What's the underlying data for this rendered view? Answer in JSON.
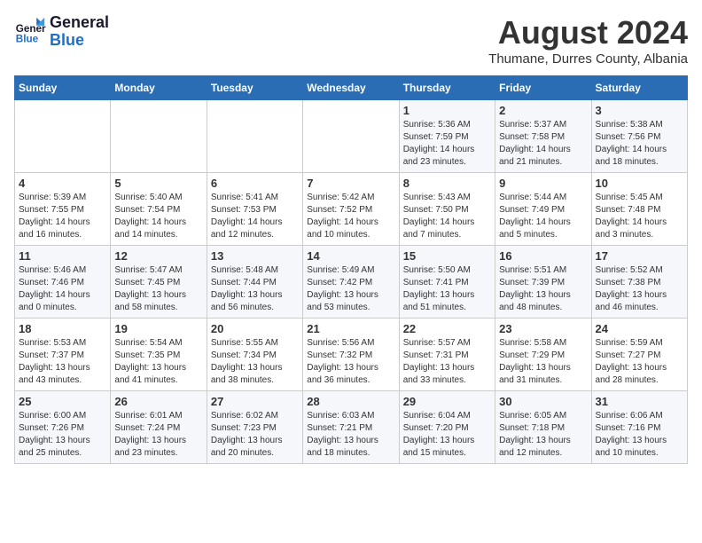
{
  "header": {
    "logo_line1": "General",
    "logo_line2": "Blue",
    "month_year": "August 2024",
    "location": "Thumane, Durres County, Albania"
  },
  "weekdays": [
    "Sunday",
    "Monday",
    "Tuesday",
    "Wednesday",
    "Thursday",
    "Friday",
    "Saturday"
  ],
  "weeks": [
    [
      {
        "day": "",
        "info": ""
      },
      {
        "day": "",
        "info": ""
      },
      {
        "day": "",
        "info": ""
      },
      {
        "day": "",
        "info": ""
      },
      {
        "day": "1",
        "info": "Sunrise: 5:36 AM\nSunset: 7:59 PM\nDaylight: 14 hours\nand 23 minutes."
      },
      {
        "day": "2",
        "info": "Sunrise: 5:37 AM\nSunset: 7:58 PM\nDaylight: 14 hours\nand 21 minutes."
      },
      {
        "day": "3",
        "info": "Sunrise: 5:38 AM\nSunset: 7:56 PM\nDaylight: 14 hours\nand 18 minutes."
      }
    ],
    [
      {
        "day": "4",
        "info": "Sunrise: 5:39 AM\nSunset: 7:55 PM\nDaylight: 14 hours\nand 16 minutes."
      },
      {
        "day": "5",
        "info": "Sunrise: 5:40 AM\nSunset: 7:54 PM\nDaylight: 14 hours\nand 14 minutes."
      },
      {
        "day": "6",
        "info": "Sunrise: 5:41 AM\nSunset: 7:53 PM\nDaylight: 14 hours\nand 12 minutes."
      },
      {
        "day": "7",
        "info": "Sunrise: 5:42 AM\nSunset: 7:52 PM\nDaylight: 14 hours\nand 10 minutes."
      },
      {
        "day": "8",
        "info": "Sunrise: 5:43 AM\nSunset: 7:50 PM\nDaylight: 14 hours\nand 7 minutes."
      },
      {
        "day": "9",
        "info": "Sunrise: 5:44 AM\nSunset: 7:49 PM\nDaylight: 14 hours\nand 5 minutes."
      },
      {
        "day": "10",
        "info": "Sunrise: 5:45 AM\nSunset: 7:48 PM\nDaylight: 14 hours\nand 3 minutes."
      }
    ],
    [
      {
        "day": "11",
        "info": "Sunrise: 5:46 AM\nSunset: 7:46 PM\nDaylight: 14 hours\nand 0 minutes."
      },
      {
        "day": "12",
        "info": "Sunrise: 5:47 AM\nSunset: 7:45 PM\nDaylight: 13 hours\nand 58 minutes."
      },
      {
        "day": "13",
        "info": "Sunrise: 5:48 AM\nSunset: 7:44 PM\nDaylight: 13 hours\nand 56 minutes."
      },
      {
        "day": "14",
        "info": "Sunrise: 5:49 AM\nSunset: 7:42 PM\nDaylight: 13 hours\nand 53 minutes."
      },
      {
        "day": "15",
        "info": "Sunrise: 5:50 AM\nSunset: 7:41 PM\nDaylight: 13 hours\nand 51 minutes."
      },
      {
        "day": "16",
        "info": "Sunrise: 5:51 AM\nSunset: 7:39 PM\nDaylight: 13 hours\nand 48 minutes."
      },
      {
        "day": "17",
        "info": "Sunrise: 5:52 AM\nSunset: 7:38 PM\nDaylight: 13 hours\nand 46 minutes."
      }
    ],
    [
      {
        "day": "18",
        "info": "Sunrise: 5:53 AM\nSunset: 7:37 PM\nDaylight: 13 hours\nand 43 minutes."
      },
      {
        "day": "19",
        "info": "Sunrise: 5:54 AM\nSunset: 7:35 PM\nDaylight: 13 hours\nand 41 minutes."
      },
      {
        "day": "20",
        "info": "Sunrise: 5:55 AM\nSunset: 7:34 PM\nDaylight: 13 hours\nand 38 minutes."
      },
      {
        "day": "21",
        "info": "Sunrise: 5:56 AM\nSunset: 7:32 PM\nDaylight: 13 hours\nand 36 minutes."
      },
      {
        "day": "22",
        "info": "Sunrise: 5:57 AM\nSunset: 7:31 PM\nDaylight: 13 hours\nand 33 minutes."
      },
      {
        "day": "23",
        "info": "Sunrise: 5:58 AM\nSunset: 7:29 PM\nDaylight: 13 hours\nand 31 minutes."
      },
      {
        "day": "24",
        "info": "Sunrise: 5:59 AM\nSunset: 7:27 PM\nDaylight: 13 hours\nand 28 minutes."
      }
    ],
    [
      {
        "day": "25",
        "info": "Sunrise: 6:00 AM\nSunset: 7:26 PM\nDaylight: 13 hours\nand 25 minutes."
      },
      {
        "day": "26",
        "info": "Sunrise: 6:01 AM\nSunset: 7:24 PM\nDaylight: 13 hours\nand 23 minutes."
      },
      {
        "day": "27",
        "info": "Sunrise: 6:02 AM\nSunset: 7:23 PM\nDaylight: 13 hours\nand 20 minutes."
      },
      {
        "day": "28",
        "info": "Sunrise: 6:03 AM\nSunset: 7:21 PM\nDaylight: 13 hours\nand 18 minutes."
      },
      {
        "day": "29",
        "info": "Sunrise: 6:04 AM\nSunset: 7:20 PM\nDaylight: 13 hours\nand 15 minutes."
      },
      {
        "day": "30",
        "info": "Sunrise: 6:05 AM\nSunset: 7:18 PM\nDaylight: 13 hours\nand 12 minutes."
      },
      {
        "day": "31",
        "info": "Sunrise: 6:06 AM\nSunset: 7:16 PM\nDaylight: 13 hours\nand 10 minutes."
      }
    ]
  ]
}
